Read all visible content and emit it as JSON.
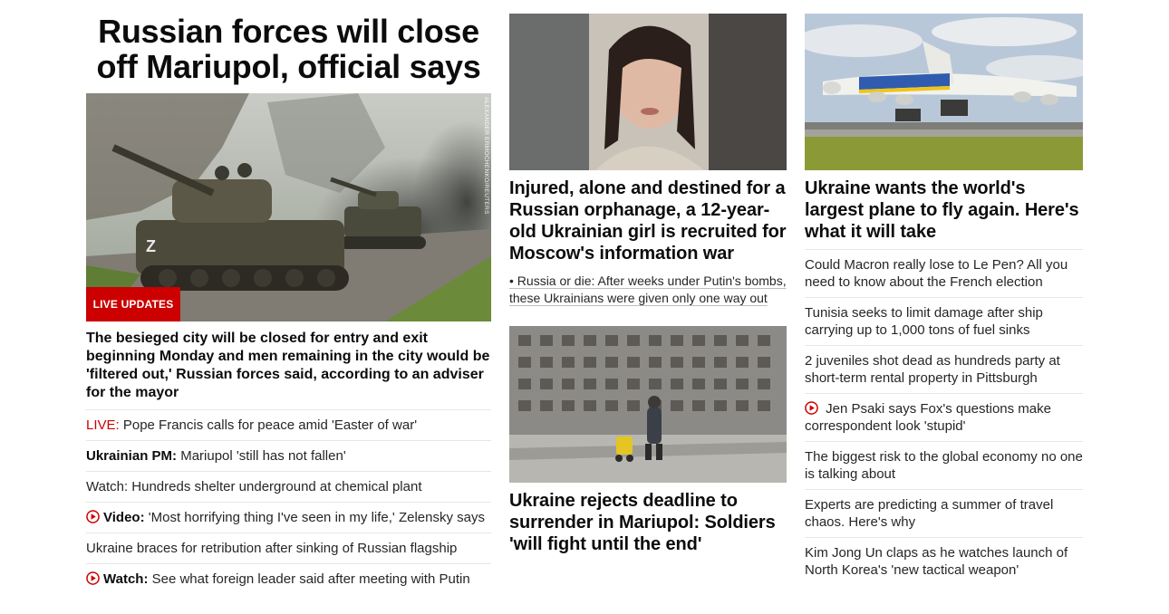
{
  "main": {
    "headline": "Russian forces will close off Mariupol, official says",
    "badge": "LIVE UPDATES",
    "photo_credit": "ALEXANDER ERMOCHENKO/REUTERS",
    "description": "The besieged city will be closed for entry and exit beginning Monday and men remaining in the city would be 'filtered out,' Russian forces said, according to an adviser for the mayor",
    "links": [
      {
        "label": "LIVE:",
        "label_style": "red",
        "text": " Pope Francis calls for peace amid 'Easter of war'"
      },
      {
        "label": "Ukrainian PM:",
        "label_style": "bold",
        "text": " Mariupol 'still has not fallen'"
      },
      {
        "label": "",
        "label_style": "none",
        "text": "Watch: Hundreds shelter underground at chemical plant"
      },
      {
        "label": "Video:",
        "label_style": "bold",
        "icon": "play-icon",
        "text": " 'Most horrifying thing I've seen in my life,' Zelensky says"
      },
      {
        "label": "",
        "label_style": "none",
        "text": "Ukraine braces for retribution after sinking of Russian flagship"
      },
      {
        "label": "Watch:",
        "label_style": "bold",
        "icon": "play-icon",
        "text": " See what foreign leader said after meeting with Putin"
      }
    ]
  },
  "middle": {
    "story1": {
      "headline": "Injured, alone and destined for a Russian orphanage, a 12-year-old Ukrainian girl is recruited for Moscow's information war",
      "sublink": "• Russia or die: After weeks under Putin's bombs, these Ukrainians were given only one way out"
    },
    "story2": {
      "headline": "Ukraine rejects deadline to surrender in Mariupol: Soldiers 'will fight until the end'"
    }
  },
  "right": {
    "story": {
      "headline": "Ukraine wants the world's largest plane to fly again. Here's what it will take"
    },
    "links": [
      {
        "text": "Could Macron really lose to Le Pen? All you need to know about the French election"
      },
      {
        "text": "Tunisia seeks to limit damage after ship carrying up to 1,000 tons of fuel sinks"
      },
      {
        "text": "2 juveniles shot dead as hundreds party at short-term rental property in Pittsburgh"
      },
      {
        "text": " Jen Psaki says Fox's questions make correspondent look 'stupid'",
        "icon": "play-icon"
      },
      {
        "text": "The biggest risk to the global economy no one is talking about"
      },
      {
        "text": "Experts are predicting a summer of travel chaos. Here's why"
      },
      {
        "text": "Kim Jong Un claps as he watches launch of North Korea's 'new tactical weapon'"
      }
    ]
  },
  "colors": {
    "accent_red": "#cc0000",
    "text": "#0c0c0c",
    "divider": "#e6e6e6"
  }
}
